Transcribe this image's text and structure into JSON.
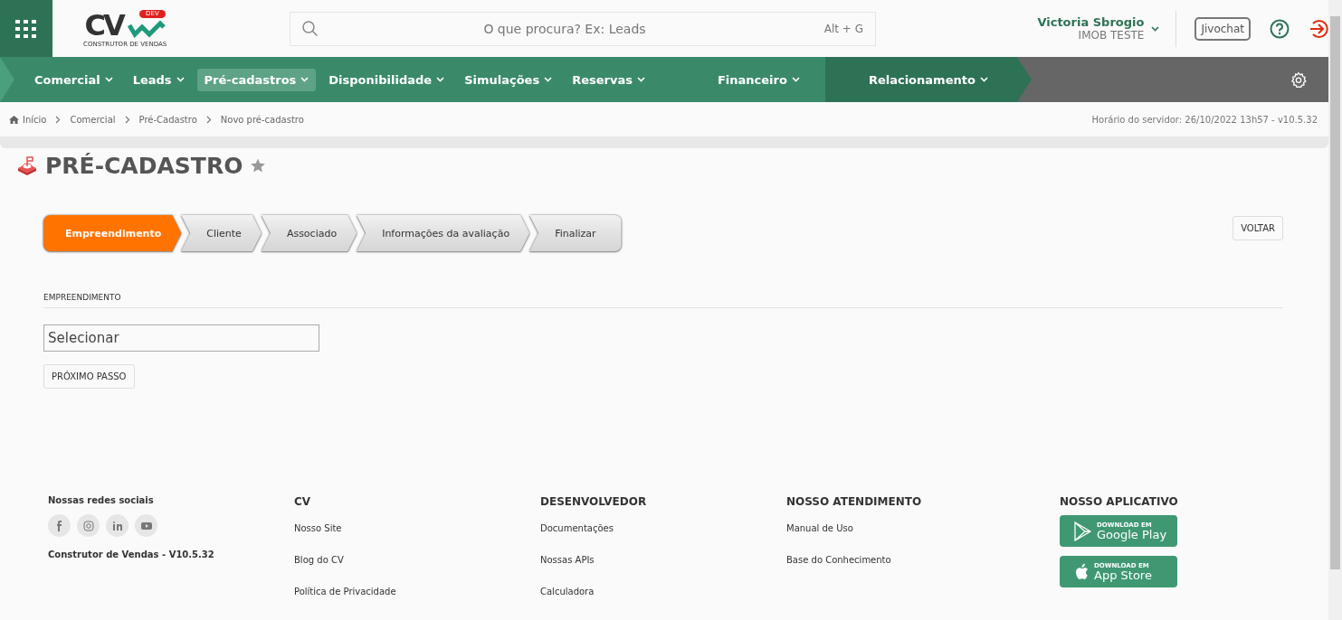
{
  "header": {
    "logo": {
      "letters": "CV",
      "badge": "DEV",
      "tagline": "CONSTRUTOR DE VENDAS"
    },
    "search": {
      "placeholder": "O que procura? Ex: Leads",
      "shortcut": "Alt + G"
    },
    "user": {
      "name": "Victoria Sbrogio",
      "company": "IMOB TESTE"
    },
    "chat_button": "Jivochat"
  },
  "nav": [
    {
      "kind": "light",
      "items": [
        {
          "label": "Comercial",
          "selected": false
        },
        {
          "label": "Leads",
          "selected": false
        },
        {
          "label": "Pré-cadastros",
          "selected": true
        },
        {
          "label": "Disponibilidade",
          "selected": false
        },
        {
          "label": "Simulações",
          "selected": false
        },
        {
          "label": "Reservas",
          "selected": false
        }
      ]
    },
    {
      "kind": "light",
      "items": [
        {
          "label": "Financeiro",
          "selected": false
        }
      ]
    },
    {
      "kind": "dark",
      "items": [
        {
          "label": "Relacionamento",
          "selected": false
        }
      ]
    }
  ],
  "breadcrumb": [
    "Início",
    "Comercial",
    "Pré-Cadastro",
    "Novo pré-cadastro"
  ],
  "server_time": "Horário do servidor: 26/10/2022 13h57 - v10.5.32",
  "page_title": "PRÉ-CADASTRO",
  "steps": [
    {
      "label": "Empreendimento",
      "selected": true
    },
    {
      "label": "Cliente",
      "selected": false
    },
    {
      "label": "Associado",
      "selected": false
    },
    {
      "label": "Informações da avaliação",
      "selected": false
    },
    {
      "label": "Finalizar",
      "selected": false
    }
  ],
  "back_button": "VOLTAR",
  "section_label": "EMPREENDIMENTO",
  "select": {
    "placeholder": "Selecionar"
  },
  "next_button": "PRÓXIMO PASSO",
  "footer": {
    "social": {
      "title": "Nossas redes sociais",
      "version": "Construtor de Vendas - V10.5.32"
    },
    "columns": [
      {
        "title": "CV",
        "links": [
          "Nosso Site",
          "Blog do CV",
          "Política de Privacidade"
        ]
      },
      {
        "title": "DESENVOLVEDOR",
        "links": [
          "Documentações",
          "Nossas APIs",
          "Calculadora"
        ]
      },
      {
        "title": "NOSSO ATENDIMENTO",
        "links": [
          "Manual de Uso",
          "Base do Conhecimento"
        ]
      }
    ],
    "app": {
      "title": "NOSSO APLICATIVO",
      "stores": [
        {
          "kind": "google",
          "caption": "DOWNLOAD EM",
          "name": "Google Play"
        },
        {
          "kind": "apple",
          "caption": "DOWNLOAD EM",
          "name": "App Store"
        }
      ]
    }
  }
}
